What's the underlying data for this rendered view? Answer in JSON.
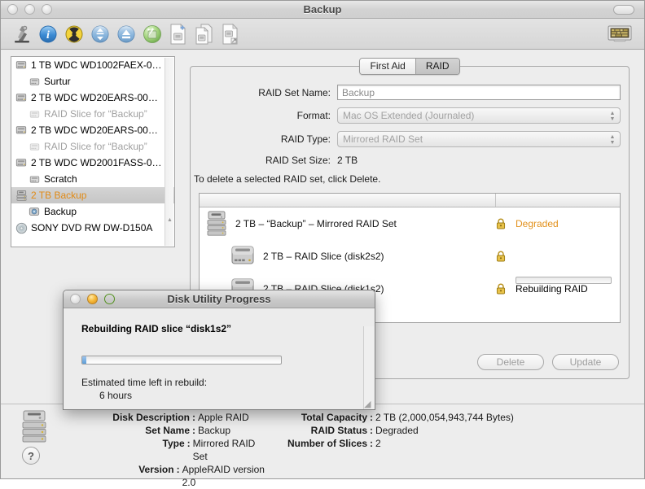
{
  "window": {
    "title": "Backup",
    "traffic_lights": [
      "close",
      "minimize",
      "zoom"
    ]
  },
  "toolbar": {
    "items": [
      {
        "name": "verify-icon",
        "label": "Verify"
      },
      {
        "name": "info-icon",
        "label": "Info"
      },
      {
        "name": "burn-icon",
        "label": "Burn"
      },
      {
        "name": "mount-icon",
        "label": "Mount"
      },
      {
        "name": "eject-icon",
        "label": "Eject"
      },
      {
        "name": "enable-journaling-icon",
        "label": "Enable Journaling"
      },
      {
        "name": "new-image-icon",
        "label": "New Image"
      },
      {
        "name": "convert-icon",
        "label": "Convert"
      },
      {
        "name": "resize-image-icon",
        "label": "Resize Image"
      }
    ],
    "log_label": "Log"
  },
  "sidebar": {
    "items": [
      {
        "label": "1 TB WDC WD1002FAEX-0…",
        "type": "disk",
        "indent": false,
        "dim": false,
        "selected": false
      },
      {
        "label": "Surtur",
        "type": "volume",
        "indent": true,
        "dim": false,
        "selected": false
      },
      {
        "label": "2 TB WDC WD20EARS-00…",
        "type": "disk",
        "indent": false,
        "dim": false,
        "selected": false
      },
      {
        "label": "RAID Slice for “Backup”",
        "type": "volume",
        "indent": true,
        "dim": true,
        "selected": false
      },
      {
        "label": "2 TB WDC WD20EARS-00…",
        "type": "disk",
        "indent": false,
        "dim": false,
        "selected": false
      },
      {
        "label": "RAID Slice for “Backup”",
        "type": "volume",
        "indent": true,
        "dim": true,
        "selected": false
      },
      {
        "label": "2 TB WDC WD2001FASS-0…",
        "type": "disk",
        "indent": false,
        "dim": false,
        "selected": false
      },
      {
        "label": "Scratch",
        "type": "volume",
        "indent": true,
        "dim": false,
        "selected": false
      },
      {
        "label": "2 TB Backup",
        "type": "raid",
        "indent": false,
        "dim": false,
        "selected": true
      },
      {
        "label": "Backup",
        "type": "mounted-volume",
        "indent": true,
        "dim": false,
        "selected": false
      },
      {
        "label": "SONY DVD RW DW-D150A",
        "type": "optical",
        "indent": false,
        "dim": false,
        "selected": false
      }
    ]
  },
  "tabs": [
    {
      "label": "First Aid",
      "active": false
    },
    {
      "label": "RAID",
      "active": true
    }
  ],
  "raid_form": {
    "set_name_label": "RAID Set Name:",
    "set_name_value": "Backup",
    "format_label": "Format:",
    "format_value": "Mac OS Extended (Journaled)",
    "raid_type_label": "RAID Type:",
    "raid_type_value": "Mirrored RAID Set",
    "set_size_label": "RAID Set Size:",
    "set_size_value": "2 TB",
    "hint": "To delete a selected RAID set, click Delete."
  },
  "raid_list": {
    "rows": [
      {
        "label": "2 TB – “Backup” – Mirrored RAID Set",
        "indent": false,
        "icon": "raid-set-icon",
        "lock": true,
        "status": "Degraded",
        "status_color": "#e2911c",
        "progress": null
      },
      {
        "label": "2 TB – RAID Slice (disk2s2)",
        "indent": true,
        "icon": "disk-icon",
        "lock": true,
        "status": "",
        "status_color": "",
        "progress": null
      },
      {
        "label": "2 TB – RAID Slice (disk1s2)",
        "indent": true,
        "icon": "disk-icon",
        "lock": true,
        "status": "Rebuilding RAID",
        "status_color": "#121212",
        "progress": 2
      }
    ]
  },
  "buttons": {
    "delete_label": "Delete",
    "update_label": "Update"
  },
  "info": {
    "left": [
      {
        "key": "Disk Description",
        "value": "Apple RAID"
      },
      {
        "key": "Set Name",
        "value": "Backup"
      },
      {
        "key": "Type",
        "value": "Mirrored RAID Set"
      },
      {
        "key": "Version",
        "value": "AppleRAID version 2.0"
      }
    ],
    "right": [
      {
        "key": "Total Capacity",
        "value": "2 TB (2,000,054,943,744 Bytes)"
      },
      {
        "key": "RAID Status",
        "value": "Degraded"
      },
      {
        "key": "Number of Slices",
        "value": "2"
      }
    ],
    "help_label": "?"
  },
  "dialog": {
    "title": "Disk Utility Progress",
    "heading": "Rebuilding RAID slice “disk1s2”",
    "eta_label": "Estimated time left in rebuild:",
    "eta_value": "6 hours",
    "progress_percent": 2
  },
  "colors": {
    "accent_orange": "#e08a16",
    "degraded_orange": "#e2911c",
    "window_bg": "#ededed",
    "list_bg": "#ffffff"
  }
}
